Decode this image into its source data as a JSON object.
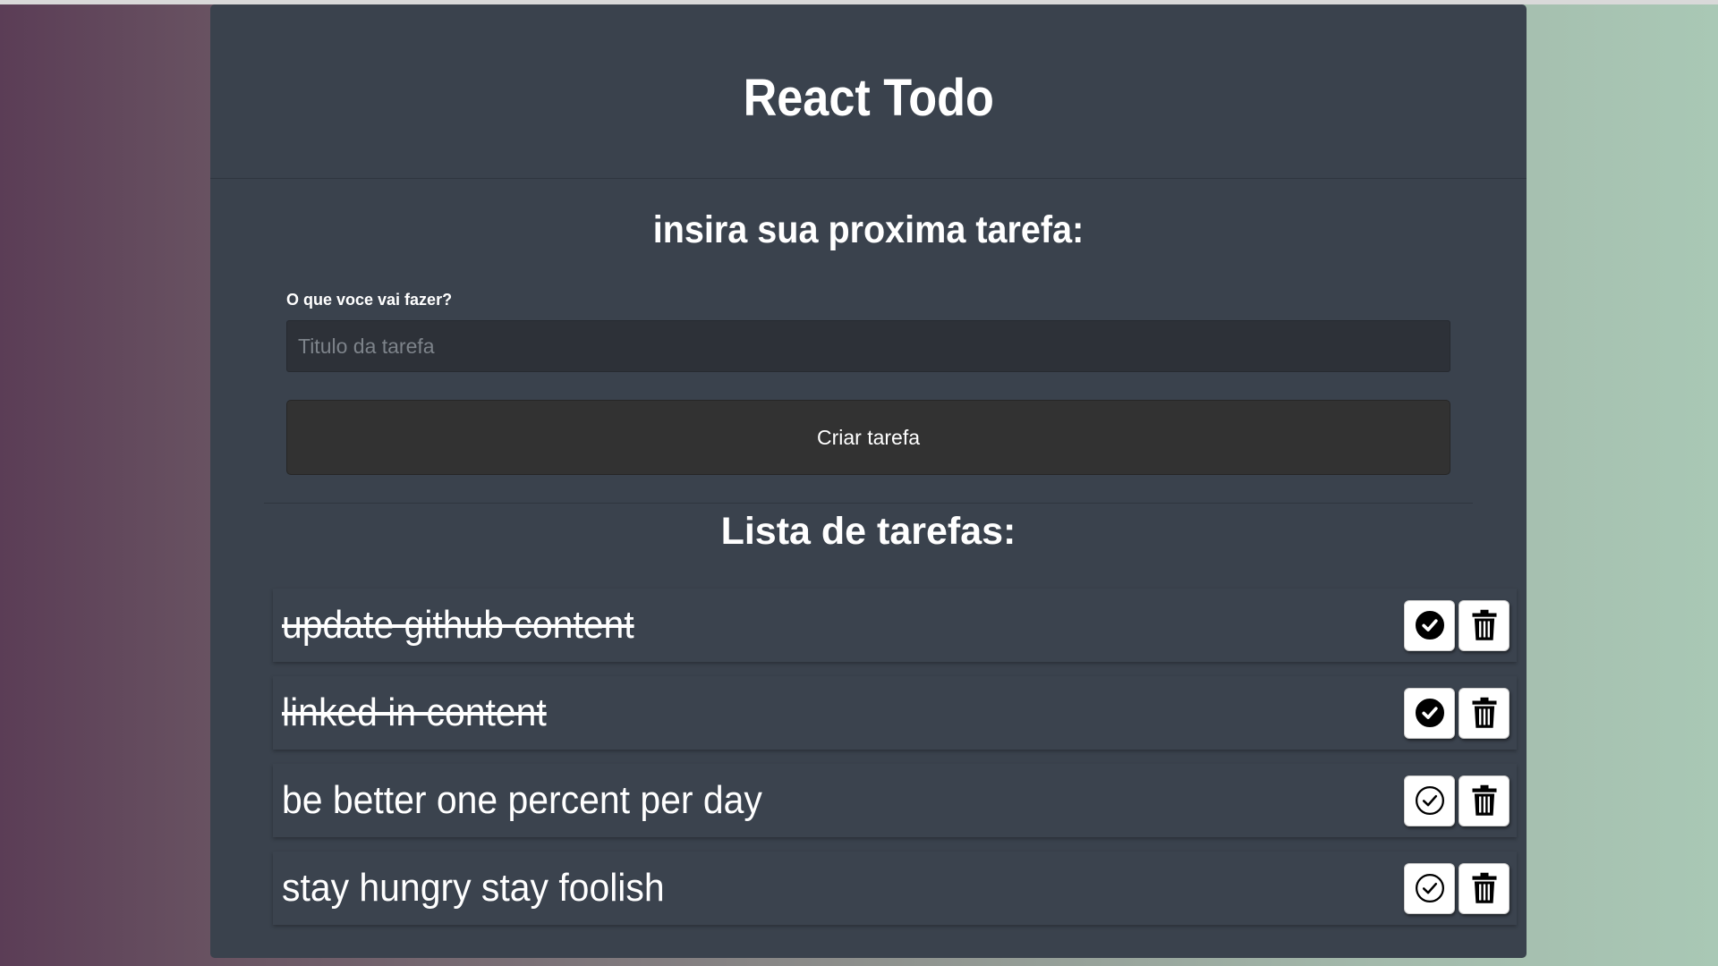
{
  "app": {
    "title": "React Todo"
  },
  "form": {
    "heading": "insira sua proxima tarefa:",
    "label": "O que voce vai fazer?",
    "input_value": "",
    "input_placeholder": "Titulo da tarefa",
    "submit_label": "Criar tarefa"
  },
  "list": {
    "heading": "Lista de tarefas:",
    "items": [
      {
        "text": "update github content",
        "completed": true
      },
      {
        "text": "linked in content",
        "completed": true
      },
      {
        "text": "be better one percent per day",
        "completed": false
      },
      {
        "text": "stay hungry stay foolish",
        "completed": false
      }
    ]
  },
  "icons": {
    "complete_done": "check-circle-filled-icon",
    "complete_pending": "check-circle-outline-icon",
    "delete": "trash-icon"
  },
  "colors": {
    "panel": "#3a424d",
    "input_bg": "#2d3138",
    "button_bg": "#323232",
    "text": "#ffffff"
  }
}
